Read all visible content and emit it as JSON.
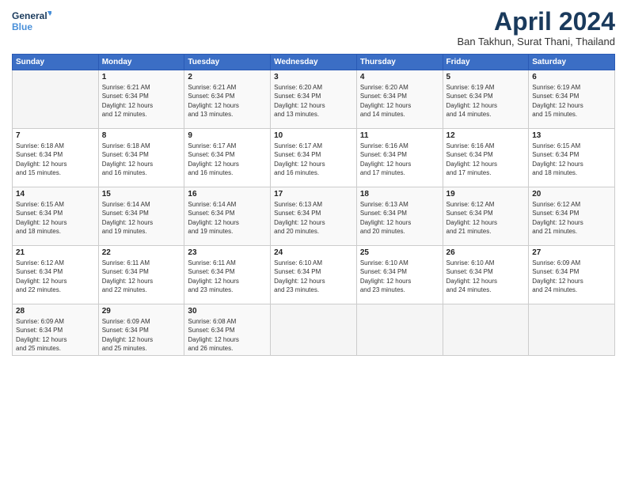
{
  "logo": {
    "line1": "General",
    "line2": "Blue"
  },
  "title": "April 2024",
  "subtitle": "Ban Takhun, Surat Thani, Thailand",
  "days_header": [
    "Sunday",
    "Monday",
    "Tuesday",
    "Wednesday",
    "Thursday",
    "Friday",
    "Saturday"
  ],
  "weeks": [
    [
      {
        "num": "",
        "info": ""
      },
      {
        "num": "1",
        "info": "Sunrise: 6:21 AM\nSunset: 6:34 PM\nDaylight: 12 hours\nand 12 minutes."
      },
      {
        "num": "2",
        "info": "Sunrise: 6:21 AM\nSunset: 6:34 PM\nDaylight: 12 hours\nand 13 minutes."
      },
      {
        "num": "3",
        "info": "Sunrise: 6:20 AM\nSunset: 6:34 PM\nDaylight: 12 hours\nand 13 minutes."
      },
      {
        "num": "4",
        "info": "Sunrise: 6:20 AM\nSunset: 6:34 PM\nDaylight: 12 hours\nand 14 minutes."
      },
      {
        "num": "5",
        "info": "Sunrise: 6:19 AM\nSunset: 6:34 PM\nDaylight: 12 hours\nand 14 minutes."
      },
      {
        "num": "6",
        "info": "Sunrise: 6:19 AM\nSunset: 6:34 PM\nDaylight: 12 hours\nand 15 minutes."
      }
    ],
    [
      {
        "num": "7",
        "info": "Sunrise: 6:18 AM\nSunset: 6:34 PM\nDaylight: 12 hours\nand 15 minutes."
      },
      {
        "num": "8",
        "info": "Sunrise: 6:18 AM\nSunset: 6:34 PM\nDaylight: 12 hours\nand 16 minutes."
      },
      {
        "num": "9",
        "info": "Sunrise: 6:17 AM\nSunset: 6:34 PM\nDaylight: 12 hours\nand 16 minutes."
      },
      {
        "num": "10",
        "info": "Sunrise: 6:17 AM\nSunset: 6:34 PM\nDaylight: 12 hours\nand 16 minutes."
      },
      {
        "num": "11",
        "info": "Sunrise: 6:16 AM\nSunset: 6:34 PM\nDaylight: 12 hours\nand 17 minutes."
      },
      {
        "num": "12",
        "info": "Sunrise: 6:16 AM\nSunset: 6:34 PM\nDaylight: 12 hours\nand 17 minutes."
      },
      {
        "num": "13",
        "info": "Sunrise: 6:15 AM\nSunset: 6:34 PM\nDaylight: 12 hours\nand 18 minutes."
      }
    ],
    [
      {
        "num": "14",
        "info": "Sunrise: 6:15 AM\nSunset: 6:34 PM\nDaylight: 12 hours\nand 18 minutes."
      },
      {
        "num": "15",
        "info": "Sunrise: 6:14 AM\nSunset: 6:34 PM\nDaylight: 12 hours\nand 19 minutes."
      },
      {
        "num": "16",
        "info": "Sunrise: 6:14 AM\nSunset: 6:34 PM\nDaylight: 12 hours\nand 19 minutes."
      },
      {
        "num": "17",
        "info": "Sunrise: 6:13 AM\nSunset: 6:34 PM\nDaylight: 12 hours\nand 20 minutes."
      },
      {
        "num": "18",
        "info": "Sunrise: 6:13 AM\nSunset: 6:34 PM\nDaylight: 12 hours\nand 20 minutes."
      },
      {
        "num": "19",
        "info": "Sunrise: 6:12 AM\nSunset: 6:34 PM\nDaylight: 12 hours\nand 21 minutes."
      },
      {
        "num": "20",
        "info": "Sunrise: 6:12 AM\nSunset: 6:34 PM\nDaylight: 12 hours\nand 21 minutes."
      }
    ],
    [
      {
        "num": "21",
        "info": "Sunrise: 6:12 AM\nSunset: 6:34 PM\nDaylight: 12 hours\nand 22 minutes."
      },
      {
        "num": "22",
        "info": "Sunrise: 6:11 AM\nSunset: 6:34 PM\nDaylight: 12 hours\nand 22 minutes."
      },
      {
        "num": "23",
        "info": "Sunrise: 6:11 AM\nSunset: 6:34 PM\nDaylight: 12 hours\nand 23 minutes."
      },
      {
        "num": "24",
        "info": "Sunrise: 6:10 AM\nSunset: 6:34 PM\nDaylight: 12 hours\nand 23 minutes."
      },
      {
        "num": "25",
        "info": "Sunrise: 6:10 AM\nSunset: 6:34 PM\nDaylight: 12 hours\nand 23 minutes."
      },
      {
        "num": "26",
        "info": "Sunrise: 6:10 AM\nSunset: 6:34 PM\nDaylight: 12 hours\nand 24 minutes."
      },
      {
        "num": "27",
        "info": "Sunrise: 6:09 AM\nSunset: 6:34 PM\nDaylight: 12 hours\nand 24 minutes."
      }
    ],
    [
      {
        "num": "28",
        "info": "Sunrise: 6:09 AM\nSunset: 6:34 PM\nDaylight: 12 hours\nand 25 minutes."
      },
      {
        "num": "29",
        "info": "Sunrise: 6:09 AM\nSunset: 6:34 PM\nDaylight: 12 hours\nand 25 minutes."
      },
      {
        "num": "30",
        "info": "Sunrise: 6:08 AM\nSunset: 6:34 PM\nDaylight: 12 hours\nand 26 minutes."
      },
      {
        "num": "",
        "info": ""
      },
      {
        "num": "",
        "info": ""
      },
      {
        "num": "",
        "info": ""
      },
      {
        "num": "",
        "info": ""
      }
    ]
  ]
}
